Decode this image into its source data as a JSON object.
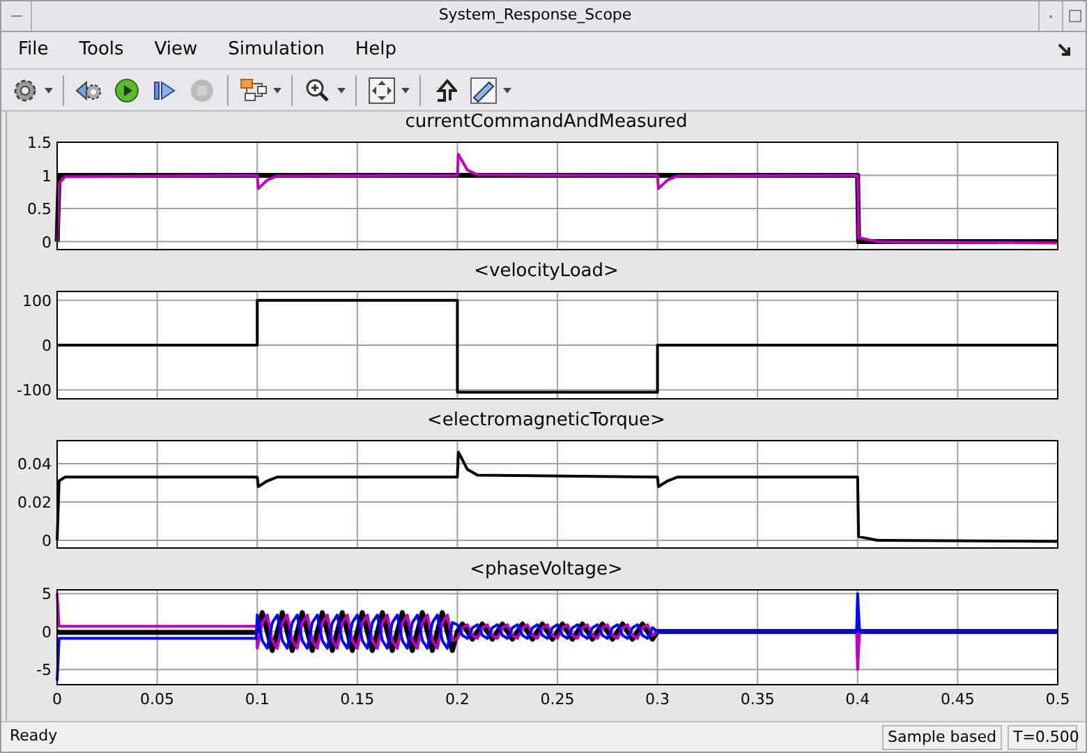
{
  "window": {
    "title": "System_Response_Scope"
  },
  "menu": [
    {
      "label": "File"
    },
    {
      "label": "Tools"
    },
    {
      "label": "View"
    },
    {
      "label": "Simulation"
    },
    {
      "label": "Help"
    }
  ],
  "toolbar": [
    {
      "kind": "settings",
      "dropdown": true,
      "disabled": false
    },
    {
      "kind": "separator"
    },
    {
      "kind": "configure",
      "dropdown": false,
      "disabled": false
    },
    {
      "kind": "run",
      "dropdown": false,
      "disabled": false
    },
    {
      "kind": "step",
      "dropdown": false,
      "disabled": false
    },
    {
      "kind": "stop",
      "dropdown": false,
      "disabled": true
    },
    {
      "kind": "separator"
    },
    {
      "kind": "highlight",
      "dropdown": true,
      "disabled": false
    },
    {
      "kind": "separator"
    },
    {
      "kind": "zoom",
      "dropdown": true,
      "disabled": false
    },
    {
      "kind": "separator"
    },
    {
      "kind": "fit",
      "dropdown": true,
      "disabled": false
    },
    {
      "kind": "separator"
    },
    {
      "kind": "signal",
      "dropdown": false,
      "disabled": false
    },
    {
      "kind": "ruler",
      "dropdown": true,
      "disabled": false
    }
  ],
  "plots": [
    {
      "chart_data": {
        "type": "line",
        "title": "currentCommandAndMeasured",
        "grid": true,
        "xlim": [
          0,
          0.5
        ],
        "ylim": [
          -0.12,
          1.5
        ],
        "yticks": [
          0,
          0.5,
          1,
          1.5
        ],
        "x": [
          0,
          0.001,
          0.004,
          0.1,
          0.1005,
          0.105,
          0.11,
          0.2,
          0.2005,
          0.205,
          0.21,
          0.3,
          0.3005,
          0.305,
          0.31,
          0.4,
          0.4005,
          0.41,
          0.5
        ],
        "series": [
          {
            "color": "#000000",
            "values": [
              0,
              1,
              1,
              1,
              1,
              1,
              1,
              1,
              1,
              1,
              1,
              1,
              1,
              1,
              1,
              1,
              0,
              0,
              0
            ]
          },
          {
            "color": "#c000c0",
            "values": [
              0,
              0.88,
              0.98,
              1,
              0.8,
              0.93,
              0.99,
              1,
              1.32,
              1.08,
              1.01,
              1,
              0.8,
              0.93,
              0.99,
              1,
              0.06,
              0,
              -0.02
            ]
          }
        ]
      }
    },
    {
      "chart_data": {
        "type": "line",
        "title": "<velocityLoad>",
        "grid": true,
        "xlim": [
          0,
          0.5
        ],
        "ylim": [
          -120,
          120
        ],
        "yticks": [
          -100,
          0,
          100
        ],
        "x": [
          0,
          0.1,
          0.1,
          0.2,
          0.2,
          0.3,
          0.3,
          0.5
        ],
        "series": [
          {
            "color": "#000000",
            "values": [
              0,
              0,
              100,
              100,
              -105,
              -105,
              0,
              0
            ]
          }
        ]
      }
    },
    {
      "chart_data": {
        "type": "line",
        "title": "<electromagneticTorque>",
        "grid": true,
        "xlim": [
          0,
          0.5
        ],
        "ylim": [
          -0.004,
          0.052
        ],
        "yticks": [
          0,
          0.02,
          0.04
        ],
        "x": [
          0,
          0.001,
          0.004,
          0.1,
          0.1005,
          0.105,
          0.11,
          0.2,
          0.2005,
          0.205,
          0.21,
          0.3,
          0.3005,
          0.305,
          0.31,
          0.4,
          0.4005,
          0.41,
          0.5
        ],
        "series": [
          {
            "color": "#000000",
            "values": [
              0,
              0.031,
              0.033,
              0.033,
              0.028,
              0.031,
              0.033,
              0.033,
              0.046,
              0.037,
              0.034,
              0.033,
              0.028,
              0.031,
              0.033,
              0.033,
              0.002,
              0,
              -0.0005
            ]
          }
        ]
      }
    },
    {
      "chart_data": {
        "type": "line",
        "title": "<phaseVoltage>",
        "grid": true,
        "xlim": [
          0,
          0.5
        ],
        "ylim": [
          -7,
          5.5
        ],
        "xticks": [
          0,
          0.05,
          0.1,
          0.15,
          0.2,
          0.25,
          0.3,
          0.35,
          0.4,
          0.45,
          0.5
        ],
        "yticks": [
          -5,
          0,
          5
        ],
        "x": [
          0,
          0.001,
          0.0995,
          0.1,
          0.1025,
          0.105,
          0.1075,
          0.11,
          0.1125,
          0.115,
          0.1175,
          0.12,
          0.1225,
          0.125,
          0.1275,
          0.13,
          0.1325,
          0.135,
          0.1375,
          0.14,
          0.1425,
          0.145,
          0.1475,
          0.15,
          0.1525,
          0.155,
          0.1575,
          0.16,
          0.1625,
          0.165,
          0.1675,
          0.17,
          0.1725,
          0.175,
          0.1775,
          0.18,
          0.1825,
          0.185,
          0.1875,
          0.19,
          0.1925,
          0.195,
          0.1975,
          0.2,
          0.2025,
          0.205,
          0.2075,
          0.21,
          0.2125,
          0.215,
          0.2175,
          0.22,
          0.2225,
          0.225,
          0.2275,
          0.23,
          0.2325,
          0.235,
          0.2375,
          0.24,
          0.2425,
          0.245,
          0.2475,
          0.25,
          0.2525,
          0.255,
          0.2575,
          0.26,
          0.2625,
          0.265,
          0.2675,
          0.27,
          0.2725,
          0.275,
          0.2775,
          0.28,
          0.2825,
          0.285,
          0.2875,
          0.29,
          0.2925,
          0.295,
          0.2975,
          0.3,
          0.3995,
          0.4,
          0.401,
          0.5
        ],
        "series": [
          {
            "color": "#000000",
            "values": [
              0,
              -0.1,
              -0.1,
              0,
              2.5,
              0,
              -2.5,
              0,
              2.5,
              0,
              -2.5,
              0,
              2.5,
              0,
              -2.5,
              0,
              2.5,
              0,
              -2.5,
              0,
              2.5,
              0,
              -2.5,
              0,
              2.5,
              0,
              -2.5,
              0,
              2.5,
              0,
              -2.5,
              0,
              2.5,
              0,
              -2.5,
              0,
              2.5,
              0,
              -2.5,
              0,
              2.5,
              0,
              -2.5,
              0,
              1,
              0,
              -1,
              0,
              1,
              0,
              -1,
              0,
              1,
              0,
              -1,
              0,
              1,
              0,
              -1,
              0,
              1,
              0,
              -1,
              0,
              1,
              0,
              -1,
              0,
              1,
              0,
              -1,
              0,
              1,
              0,
              -1,
              0,
              1,
              0,
              -1,
              0,
              1,
              0,
              -1,
              0,
              0,
              0,
              0,
              0
            ]
          },
          {
            "color": "#c000c0",
            "values": [
              5,
              0.7,
              0.7,
              -2.2,
              1.2,
              2.2,
              -1.2,
              -2.2,
              1.2,
              2.2,
              -1.2,
              -2.2,
              1.2,
              2.2,
              -1.2,
              -2.2,
              1.2,
              2.2,
              -1.2,
              -2.2,
              1.2,
              2.2,
              -1.2,
              -2.2,
              1.2,
              2.2,
              -1.2,
              -2.2,
              1.2,
              2.2,
              -1.2,
              -2.2,
              1.2,
              2.2,
              -1.2,
              -2.2,
              1.2,
              2.2,
              -1.2,
              -2.2,
              1.2,
              2.2,
              -1.2,
              -0.9,
              0.5,
              0.9,
              -0.5,
              -0.9,
              0.5,
              0.9,
              -0.5,
              -0.9,
              0.5,
              0.9,
              -0.5,
              -0.9,
              0.5,
              0.9,
              -0.5,
              -0.9,
              0.5,
              0.9,
              -0.5,
              -0.9,
              0.5,
              0.9,
              -0.5,
              -0.9,
              0.5,
              0.9,
              -0.5,
              -0.9,
              0.5,
              0.9,
              -0.5,
              -0.9,
              0.5,
              0.9,
              -0.5,
              -0.9,
              0.5,
              0.9,
              -0.5,
              0,
              0,
              -5,
              0,
              0
            ]
          },
          {
            "color": "#0000ff",
            "values": [
              -6.5,
              -0.9,
              -0.9,
              2.2,
              -1.2,
              -2.2,
              1.2,
              2.2,
              -1.2,
              -2.2,
              1.2,
              2.2,
              -1.2,
              -2.2,
              1.2,
              2.2,
              -1.2,
              -2.2,
              1.2,
              2.2,
              -1.2,
              -2.2,
              1.2,
              2.2,
              -1.2,
              -2.2,
              1.2,
              2.2,
              -1.2,
              -2.2,
              1.2,
              2.2,
              -1.2,
              -2.2,
              1.2,
              2.2,
              -1.2,
              -2.2,
              1.2,
              2.2,
              -1.2,
              -2.2,
              1.2,
              0.9,
              -0.5,
              -0.9,
              0.5,
              0.9,
              -0.5,
              -0.9,
              0.5,
              0.9,
              -0.5,
              -0.9,
              0.5,
              0.9,
              -0.5,
              -0.9,
              0.5,
              0.9,
              -0.5,
              -0.9,
              0.5,
              0.9,
              -0.5,
              -0.9,
              0.5,
              0.9,
              -0.5,
              -0.9,
              0.5,
              0.9,
              -0.5,
              -0.9,
              0.5,
              0.9,
              -0.5,
              -0.9,
              0.5,
              0.9,
              -0.5,
              -0.9,
              0.5,
              0,
              0,
              5,
              0,
              0
            ]
          }
        ]
      }
    }
  ],
  "status_bar": {
    "message": "Ready",
    "mode": "Sample based",
    "time": "T=0.500"
  }
}
